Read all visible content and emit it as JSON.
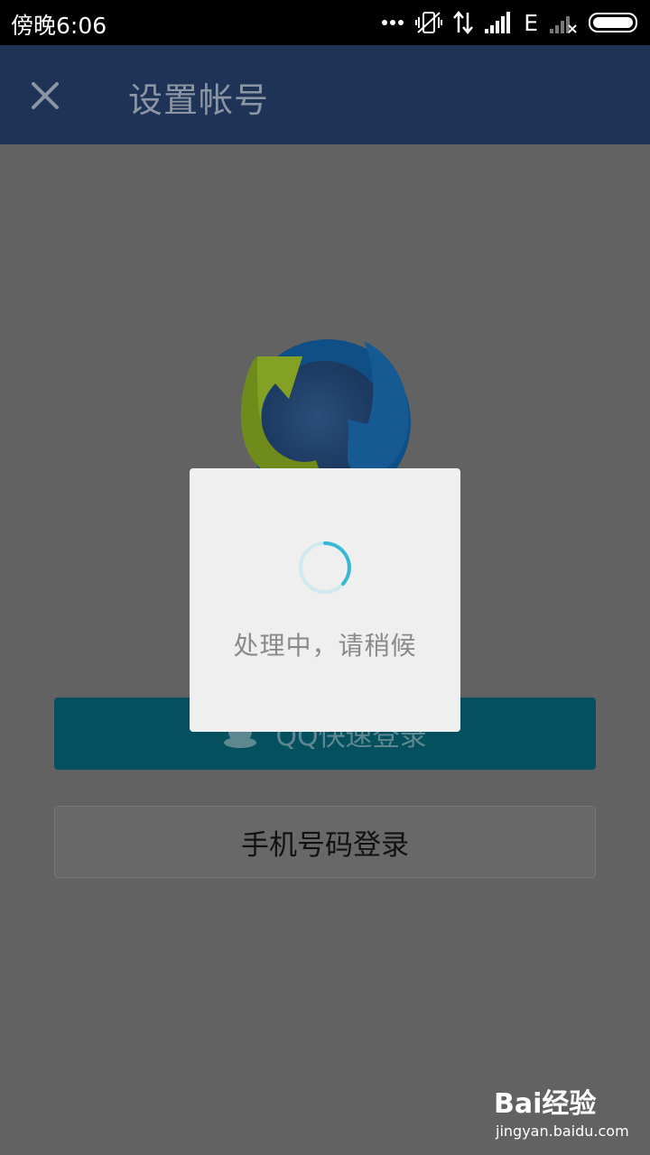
{
  "status_bar": {
    "time": "傍晚6:06",
    "network_type": "E",
    "icons": [
      "more-dots-icon",
      "vibrate-off-icon",
      "data-transfer-icon",
      "signal-icon",
      "no-signal-icon",
      "battery-icon"
    ]
  },
  "header": {
    "close_icon": "close-icon",
    "title": "设置帐号"
  },
  "logo": {
    "name": "sync-logo"
  },
  "buttons": {
    "qq_login": "QQ快速登录",
    "phone_login": "手机号码登录"
  },
  "dialog": {
    "message": "处理中，请稍候"
  },
  "watermark": {
    "brand": "Bai经验",
    "url": "jingyan.baidu.com"
  },
  "colors": {
    "header_bg": "#1e3356",
    "overlay_bg": "#626262",
    "qq_button_bg": "#05505f",
    "spinner": "#39b8d6"
  }
}
